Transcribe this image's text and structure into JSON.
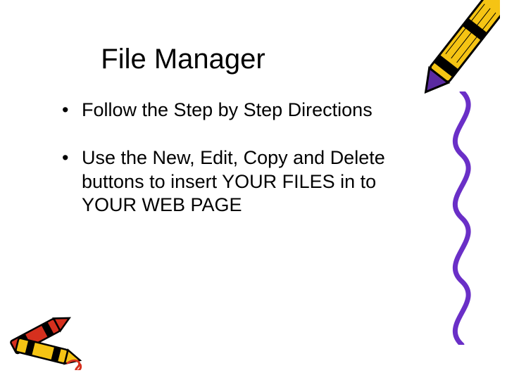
{
  "slide": {
    "title": "File Manager",
    "bullets": [
      "Follow the Step by Step Directions",
      "Use the New, Edit, Copy and Delete buttons to insert YOUR FILES in to YOUR WEB PAGE"
    ]
  },
  "decor": {
    "crayon_top": "yellow-crayon-icon",
    "squiggle": "purple-squiggle-icon",
    "crayons_bottom": "crayon-pair-icon"
  }
}
